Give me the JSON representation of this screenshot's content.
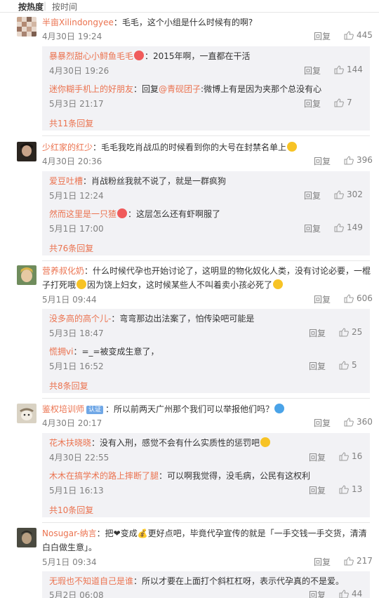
{
  "sort": {
    "hot": "按热度",
    "separator": "|",
    "time": "按时间"
  },
  "labels": {
    "reply": "回复"
  },
  "comments": [
    {
      "user": "半亩Xilindongyee",
      "text": "：毛毛，这个小组是什么时候有的啊?",
      "time": "4月30日 19:24",
      "likes": "445",
      "replies": [
        {
          "user": "暴暴烈甜心小鲟鱼毛毛",
          "text": "：2015年啊，一直都在干活",
          "time": "4月30日 19:26",
          "likes": "144"
        },
        {
          "user": "迷你糊手机上的好朋友",
          "text_prefix": "：回复",
          "mention": "@青砚团子",
          "text": ":微博上有是因为夹那个总没有心",
          "time": "5月3日 21:17",
          "likes": "7"
        }
      ],
      "more": "共11条回复"
    },
    {
      "user": "少红家的红少",
      "text": "：毛毛我吃肖战瓜的时候看到你的大号在封禁名单上",
      "time": "4月30日 20:36",
      "likes": "396",
      "replies": [
        {
          "user": "爱豆吐槽",
          "text": "：肖战粉丝我就不说了，就是一群疯狗",
          "time": "5月1日 12:24",
          "likes": "302"
        },
        {
          "user": "然而这里是一只猹",
          "text": "：这层怎么还有虾啊服了",
          "time": "5月1日 17:00",
          "likes": "149"
        }
      ],
      "more": "共76条回复"
    },
    {
      "user": "营养叔化奶",
      "text": "：什么时候代孕也开始讨论了，这明显的物化奴化人类，没有讨论必要，一棍子打死哦",
      "text2": "因为饶上妇女，这时候某些人不叫着卖小孩必死了",
      "time": "5月1日 09:44",
      "likes": "606",
      "replies": [
        {
          "user": "没多高的高个儿-",
          "text": "：弯弯那边出法案了，怕传染吧可能是",
          "time": "5月3日 18:47",
          "likes": "25"
        },
        {
          "user": "慌拥vi",
          "text": "：=_=被变成生意了，",
          "time": "5月1日 16:52",
          "likes": "5"
        }
      ],
      "more": "共8条回复"
    },
    {
      "user": "鉴权培训师",
      "badge": "认证",
      "text": "：所以前两天广州那个我们可以举报他们吗？",
      "time": "4月30日 20:17",
      "likes": "360",
      "replies": [
        {
          "user": "花木扶晓晓",
          "text": "：没有入刑，感觉不会有什么实质性的惩罚吧",
          "time": "4月30日 22:55",
          "likes": "16"
        },
        {
          "user": "木木在搞学术的路上摔断了腿",
          "text": "：可以啊我觉得，没毛病，公民有这权利",
          "time": "5月1日 16:13",
          "likes": "13"
        }
      ],
      "more": "共10条回复"
    },
    {
      "user": "Nosugar-纳言",
      "text": "：把❤变成💰更好点吧，毕竟代孕宣传的就是「一手交钱一手交货，清清白",
      "text2": "白做生意」。",
      "time": "5月1日 09:34",
      "likes": "217",
      "replies": [
        {
          "user": "无瑕也不知道自己是谁",
          "text": "：所以才要在上面打个斜杠杠呀，表示代孕真的不是爱。",
          "time": "5月2日 06:08",
          "likes": "44"
        }
      ]
    }
  ],
  "colors": {
    "accent": "#eb7350",
    "meta": "#808080",
    "reply_bg": "#f2f2f5"
  }
}
